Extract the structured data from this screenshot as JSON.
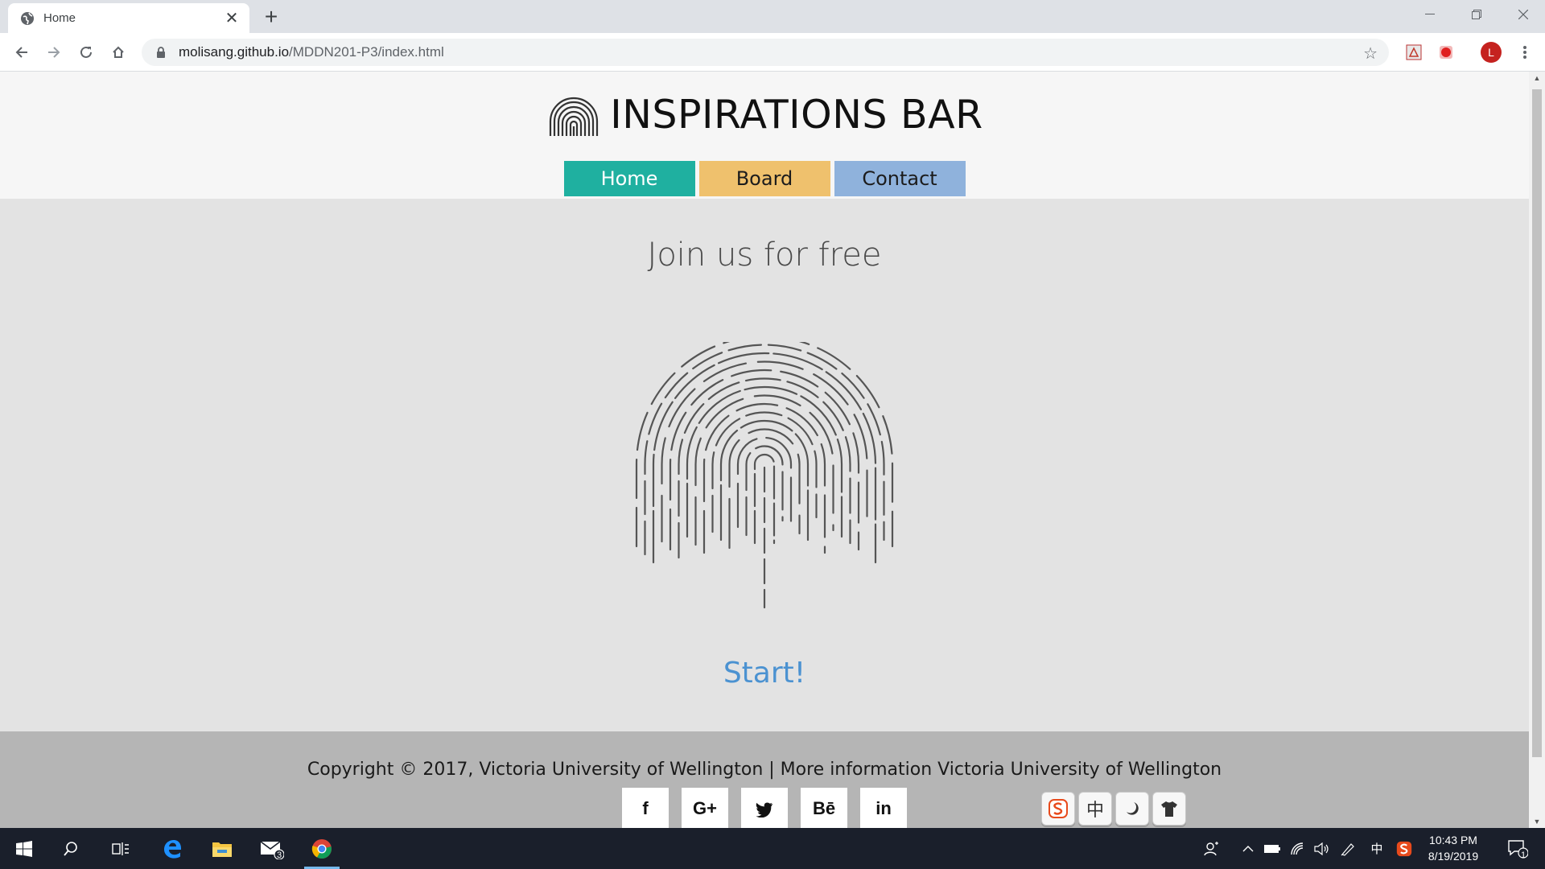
{
  "browser": {
    "tab_title": "Home",
    "tab_close": "✕",
    "new_tab": "+",
    "url_host": "molisang.github.io",
    "url_path": "/MDDN201-P3/index.html",
    "profile_initial": "L"
  },
  "site": {
    "title": "INSPIRATIONS BAR",
    "nav": {
      "home": "Home",
      "board": "Board",
      "contact": "Contact"
    },
    "headline": "Join us for free",
    "cta": "Start!",
    "copyright": "Copyright © 2017, Victoria University of Wellington | More information Victoria University of Wellington",
    "social": [
      "f",
      "G+",
      "",
      "Bē",
      "in"
    ],
    "social_icons": [
      "facebook-icon",
      "google-plus-icon",
      "twitter-icon",
      "behance-icon",
      "linkedin-icon"
    ]
  },
  "ime": {
    "icons": [
      "sogou-icon",
      "chinese-mode-icon",
      "moon-icon",
      "skin-icon"
    ],
    "chinese_label": "中"
  },
  "taskbar": {
    "mail_badge": "3",
    "ime_indicator": "中",
    "time": "10:43 PM",
    "date": "8/19/2019",
    "notification_count": "1"
  },
  "colors": {
    "nav_home": "#1fb0a0",
    "nav_board": "#efc16d",
    "nav_contact": "#8fb2dc",
    "cta": "#4b92d1"
  }
}
